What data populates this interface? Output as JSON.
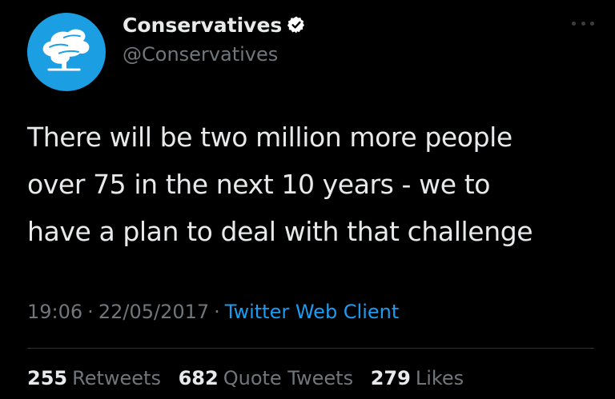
{
  "colors": {
    "background": "#000000",
    "primary_text": "#e7e9ea",
    "secondary_text": "#71767b",
    "accent": "#1d9bf0",
    "avatar_bg": "#1c9ee2",
    "divider": "#2f3336"
  },
  "tweet": {
    "account": {
      "name": "Conservatives",
      "handle": "@Conservatives",
      "verified": true,
      "avatar_icon": "tree-logo-icon",
      "verified_icon": "verified-badge-icon"
    },
    "text": "There will be two million more people\nover 75 in the next 10 years - we to\nhave a plan to deal with that challenge",
    "meta": {
      "time": "19:06",
      "date": "22/05/2017",
      "separator": "·",
      "source": "Twitter Web Client"
    },
    "stats": [
      {
        "count": "255",
        "label": "Retweets"
      },
      {
        "count": "682",
        "label": "Quote Tweets"
      },
      {
        "count": "279",
        "label": "Likes"
      }
    ],
    "more_icon": "more-options-icon"
  }
}
